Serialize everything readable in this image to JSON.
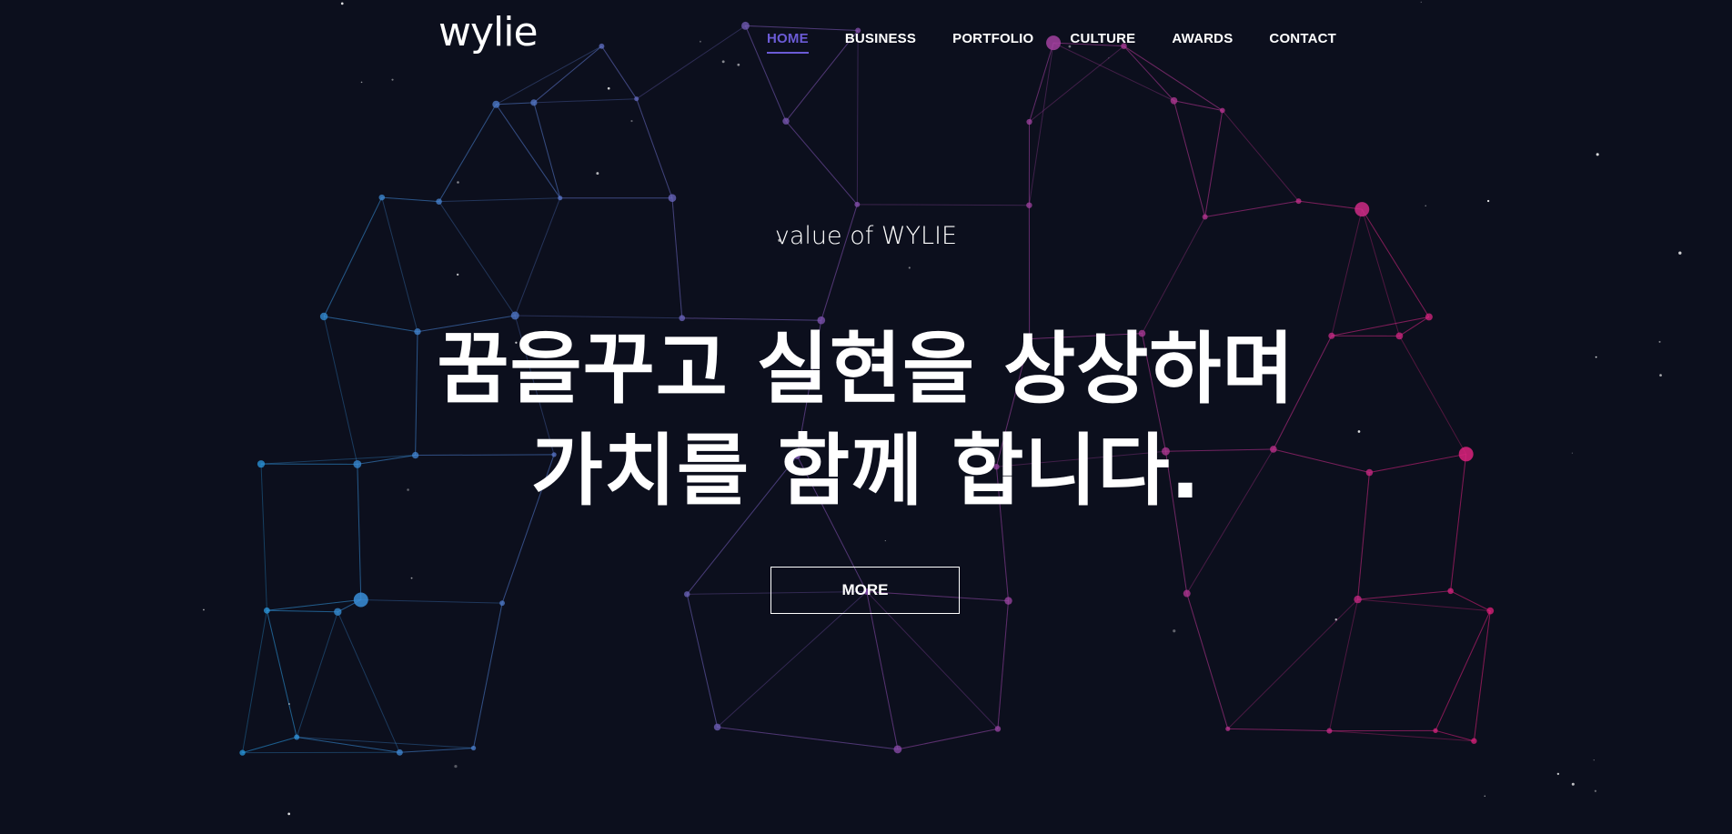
{
  "brand": {
    "logo_text": "wylie"
  },
  "nav": {
    "items": [
      {
        "label": "HOME",
        "active": true
      },
      {
        "label": "BUSINESS",
        "active": false
      },
      {
        "label": "PORTFOLIO",
        "active": false
      },
      {
        "label": "CULTURE",
        "active": false
      },
      {
        "label": "AWARDS",
        "active": false
      },
      {
        "label": "CONTACT",
        "active": false
      }
    ]
  },
  "hero": {
    "subtitle": "value of WYLIE",
    "headline_line1": "꿈을꾸고 실현을 상상하며",
    "headline_line2": "가치를 함께 합니다.",
    "more_label": "MORE"
  },
  "colors": {
    "background": "#0c0f1d",
    "accent": "#6b5bd6",
    "network_left": "#2a9be0",
    "network_right": "#e0207a"
  }
}
